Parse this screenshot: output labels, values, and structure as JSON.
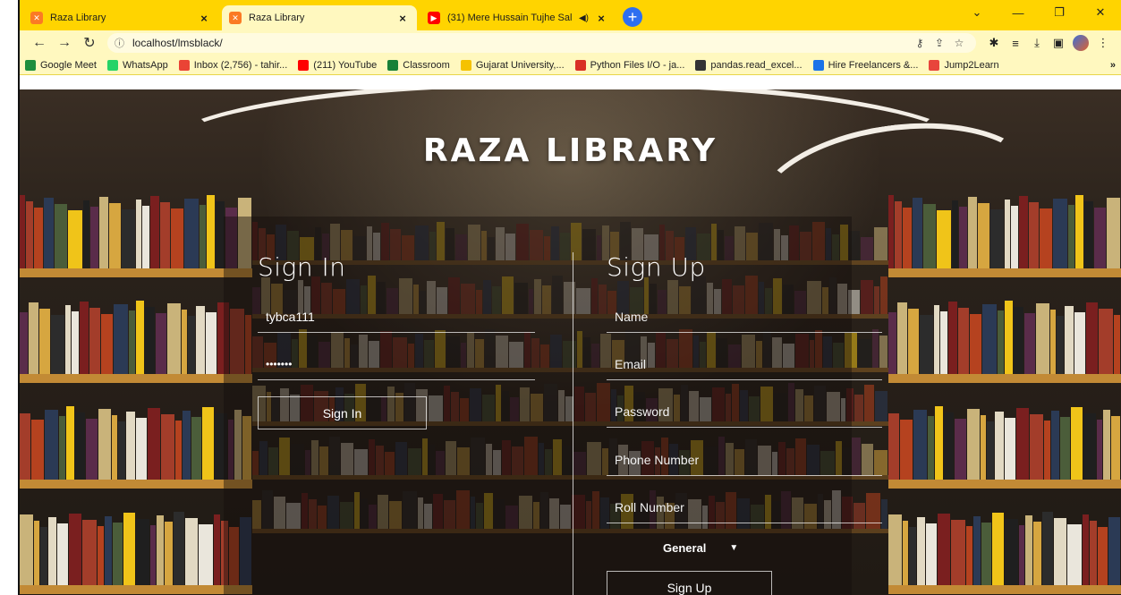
{
  "browser": {
    "tabs": [
      {
        "title": "Raza Library",
        "active": false
      },
      {
        "title": "Raza Library",
        "active": true
      },
      {
        "title": "(31) Mere Hussain Tujhe Sal",
        "active": false
      }
    ],
    "url": "localhost/lmsblack/",
    "bookmarks": [
      {
        "label": "Google Meet",
        "color": "#1e8e3e"
      },
      {
        "label": "WhatsApp",
        "color": "#25d366"
      },
      {
        "label": "Inbox (2,756) - tahir...",
        "color": "#ea4335"
      },
      {
        "label": "(211) YouTube",
        "color": "#ff0000"
      },
      {
        "label": "Classroom",
        "color": "#188038"
      },
      {
        "label": "Gujarat University,...",
        "color": "#f5c200"
      },
      {
        "label": "Python Files I/O - ja...",
        "color": "#d93025"
      },
      {
        "label": "pandas.read_excel...",
        "color": "#333333"
      },
      {
        "label": "Hire Freelancers &...",
        "color": "#1a73e8"
      },
      {
        "label": "Jump2Learn",
        "color": "#e8453c"
      }
    ],
    "more": "»"
  },
  "page": {
    "title": "RAZA LIBRARY",
    "signin": {
      "heading": "Sign In",
      "username": "tybca111",
      "password": "•••••••",
      "button": "Sign In"
    },
    "signup": {
      "heading": "Sign Up",
      "name_placeholder": "Name",
      "email_placeholder": "Email",
      "password_placeholder": "Password",
      "phone_placeholder": "Phone Number",
      "roll_placeholder": "Roll Number",
      "category": "General",
      "button": "Sign Up"
    }
  }
}
